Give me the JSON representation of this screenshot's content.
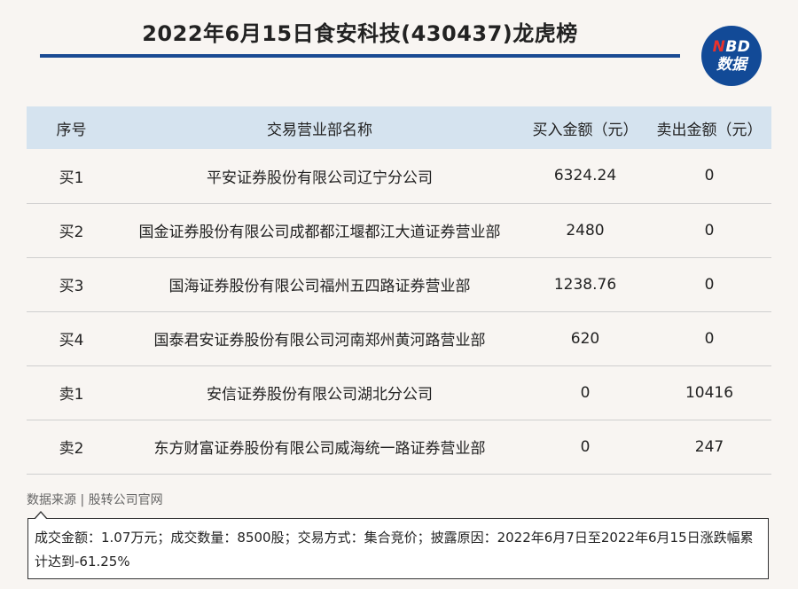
{
  "title": "2022年6月15日食安科技(430437)龙虎榜",
  "logo": {
    "line1_accent": "N",
    "line1_rest": "BD",
    "line2": "数据"
  },
  "colors": {
    "accent": "#1a4b93",
    "header_bg": "#d5e3ef",
    "logo_red": "#e8322c"
  },
  "table": {
    "headers": [
      "序号",
      "交易营业部名称",
      "买入金额（元）",
      "卖出金额（元）"
    ],
    "rows": [
      {
        "seq": "买1",
        "name": "平安证券股份有限公司辽宁分公司",
        "buy": "6324.24",
        "sell": "0"
      },
      {
        "seq": "买2",
        "name": "国金证券股份有限公司成都都江堰都江大道证券营业部",
        "buy": "2480",
        "sell": "0"
      },
      {
        "seq": "买3",
        "name": "国海证券股份有限公司福州五四路证券营业部",
        "buy": "1238.76",
        "sell": "0"
      },
      {
        "seq": "买4",
        "name": "国泰君安证券股份有限公司河南郑州黄河路营业部",
        "buy": "620",
        "sell": "0"
      },
      {
        "seq": "卖1",
        "name": "安信证券股份有限公司湖北分公司",
        "buy": "0",
        "sell": "10416"
      },
      {
        "seq": "卖2",
        "name": "东方财富证券股份有限公司威海统一路证券营业部",
        "buy": "0",
        "sell": "247"
      }
    ]
  },
  "source": "数据来源 | 股转公司官网",
  "note": "成交金额：1.07万元；成交数量：8500股；交易方式：集合竞价；披露原因：2022年6月7日至2022年6月15日涨跌幅累计达到-61.25%"
}
